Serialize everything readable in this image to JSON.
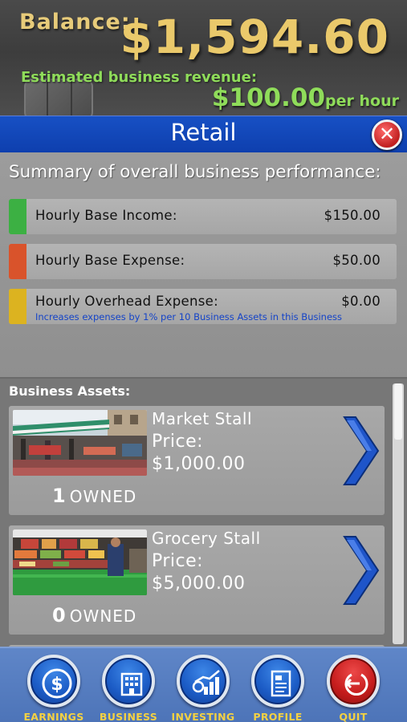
{
  "header": {
    "balance_label": "Balance:",
    "balance_value": "$1,594.60",
    "revenue_label": "Estimated business revenue:",
    "revenue_amount": "$100.00",
    "revenue_unit": "per hour"
  },
  "title_bar": {
    "title": "Retail",
    "close_symbol": "✕"
  },
  "summary": {
    "title": "Summary of overall business performance:",
    "rows": [
      {
        "label": "Hourly Base Income:",
        "value": "$150.00",
        "color": "#3cb043"
      },
      {
        "label": "Hourly Base Expense:",
        "value": "$50.00",
        "color": "#d9532b"
      },
      {
        "label": "Hourly Overhead Expense:",
        "value": "$0.00",
        "color": "#dcb320",
        "note": "Increases expenses by 1% per 10 Business Assets in this Business"
      }
    ]
  },
  "assets": {
    "title": "Business Assets:",
    "items": [
      {
        "name": "Market Stall",
        "price_label": "Price:",
        "price": "$1,000.00",
        "owned_count": "1",
        "owned_label": "OWNED",
        "image": "market-stall"
      },
      {
        "name": "Grocery Stall",
        "price_label": "Price:",
        "price": "$5,000.00",
        "owned_count": "0",
        "owned_label": "OWNED",
        "image": "grocery-stall"
      }
    ]
  },
  "nav": {
    "items": [
      {
        "label": "EARNINGS",
        "icon": "dollar-icon"
      },
      {
        "label": "BUSINESS",
        "icon": "building-icon"
      },
      {
        "label": "INVESTING",
        "icon": "chart-icon"
      },
      {
        "label": "PROFILE",
        "icon": "document-icon"
      },
      {
        "label": "QUIT",
        "icon": "exit-icon"
      }
    ]
  },
  "colors": {
    "balance_gold": "#eac96b",
    "revenue_green": "#8fdc5a",
    "title_blue": "#1750c4",
    "nav_label_yellow": "#f4d142",
    "note_blue": "#1544c8",
    "arrow_blue": "#1f55c9"
  }
}
